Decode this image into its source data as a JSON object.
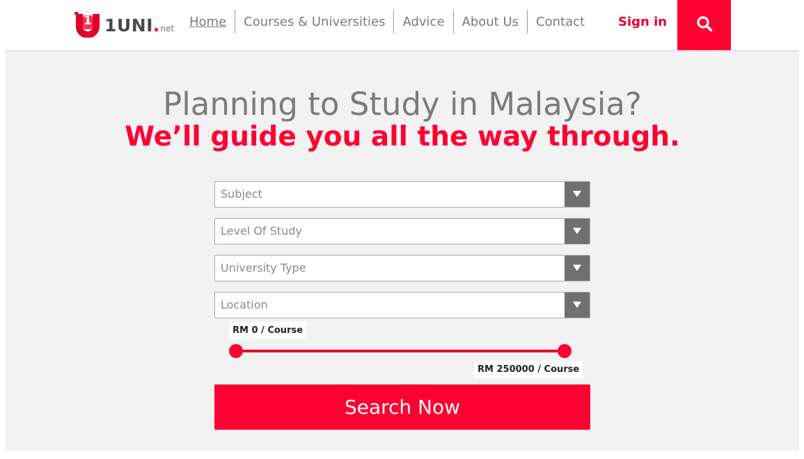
{
  "brand": {
    "logo_glyph": "1",
    "name": "1UNI",
    "dot": ".",
    "tld": "net",
    "color": "#ff0033"
  },
  "nav": {
    "items": [
      {
        "label": "Home"
      },
      {
        "label": "Courses & Universities"
      },
      {
        "label": "Advice"
      },
      {
        "label": "About Us"
      },
      {
        "label": "Contact"
      }
    ],
    "sign_in": "Sign in",
    "search_icon": "search-icon"
  },
  "hero": {
    "title": "Planning to Study in Malaysia?",
    "subtitle": "We’ll guide you all the way through."
  },
  "filters": [
    {
      "placeholder": "Subject"
    },
    {
      "placeholder": "Level Of Study"
    },
    {
      "placeholder": "University Type"
    },
    {
      "placeholder": "Location"
    }
  ],
  "price_range": {
    "min_label": "RM 0 / Course",
    "max_label": "RM 250000 / Course",
    "min": 0,
    "max": 250000,
    "currency": "RM"
  },
  "cta": {
    "label": "Search Now"
  },
  "colors": {
    "accent": "#ff0033",
    "title_gray": "#7b7b7b",
    "hero_bg": "#f2f2f2",
    "dropdown_arrow_bg": "#707070"
  }
}
